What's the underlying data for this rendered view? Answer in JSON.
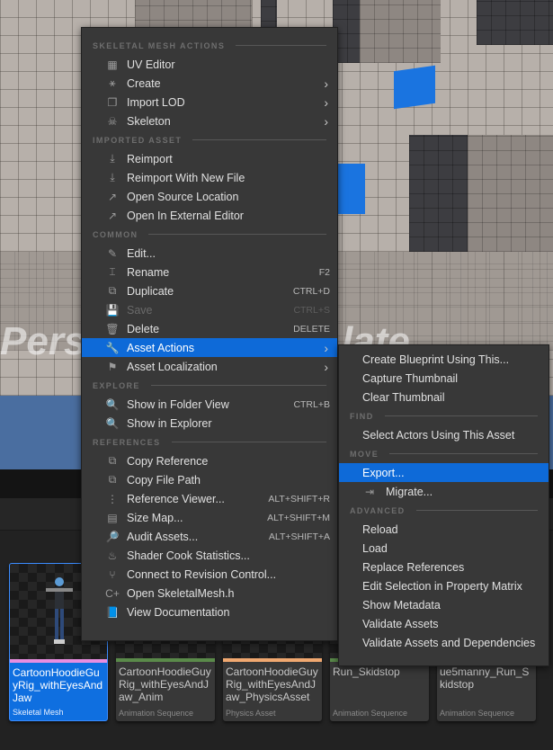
{
  "viewport": {
    "overlay_text_left": "Pers",
    "overlay_text_right": "late"
  },
  "main_menu": {
    "sections": [
      {
        "header": "SKELETAL MESH ACTIONS",
        "items": [
          {
            "label": "UV Editor",
            "icon": "uv-grid-icon",
            "glyph": "▦",
            "shortcut": "",
            "submenu": false
          },
          {
            "label": "Create",
            "icon": "create-animation-icon",
            "glyph": "⚹",
            "shortcut": "",
            "submenu": true
          },
          {
            "label": "Import LOD",
            "icon": "import-lod-icon",
            "glyph": "❐",
            "shortcut": "",
            "submenu": true
          },
          {
            "label": "Skeleton",
            "icon": "skeleton-icon",
            "glyph": "☠",
            "shortcut": "",
            "submenu": true
          }
        ]
      },
      {
        "header": "IMPORTED ASSET",
        "items": [
          {
            "label": "Reimport",
            "icon": "reimport-icon",
            "glyph": "⤓",
            "shortcut": "",
            "submenu": false
          },
          {
            "label": "Reimport With New File",
            "icon": "reimport-new-file-icon",
            "glyph": "⤓",
            "shortcut": "",
            "submenu": false
          },
          {
            "label": "Open Source Location",
            "icon": "open-source-location-icon",
            "glyph": "↗",
            "shortcut": "",
            "submenu": false
          },
          {
            "label": "Open In External Editor",
            "icon": "open-external-editor-icon",
            "glyph": "↗",
            "shortcut": "",
            "submenu": false
          }
        ]
      },
      {
        "header": "COMMON",
        "items": [
          {
            "label": "Edit...",
            "icon": "edit-pencil-icon",
            "glyph": "✎",
            "shortcut": "",
            "submenu": false
          },
          {
            "label": "Rename",
            "icon": "rename-icon",
            "glyph": "⌶",
            "shortcut": "F2",
            "submenu": false
          },
          {
            "label": "Duplicate",
            "icon": "duplicate-icon",
            "glyph": "⧉",
            "shortcut": "CTRL+D",
            "submenu": false
          },
          {
            "label": "Save",
            "icon": "save-icon",
            "glyph": "💾",
            "shortcut": "CTRL+S",
            "submenu": false,
            "disabled": true
          },
          {
            "label": "Delete",
            "icon": "trash-icon",
            "glyph": "🗑",
            "shortcut": "DELETE",
            "submenu": false
          },
          {
            "label": "Asset Actions",
            "icon": "wrench-icon",
            "glyph": "🔧",
            "shortcut": "",
            "submenu": true,
            "highlighted": true
          },
          {
            "label": "Asset Localization",
            "icon": "flag-icon",
            "glyph": "⚑",
            "shortcut": "",
            "submenu": true
          }
        ]
      },
      {
        "header": "EXPLORE",
        "items": [
          {
            "label": "Show in Folder View",
            "icon": "folder-search-icon",
            "glyph": "🔍",
            "shortcut": "CTRL+B",
            "submenu": false
          },
          {
            "label": "Show in Explorer",
            "icon": "folder-search-icon",
            "glyph": "🔍",
            "shortcut": "",
            "submenu": false
          }
        ]
      },
      {
        "header": "REFERENCES",
        "items": [
          {
            "label": "Copy Reference",
            "icon": "copy-reference-icon",
            "glyph": "⧉",
            "shortcut": "",
            "submenu": false
          },
          {
            "label": "Copy File Path",
            "icon": "copy-path-icon",
            "glyph": "⧉",
            "shortcut": "",
            "submenu": false
          },
          {
            "label": "Reference Viewer...",
            "icon": "reference-viewer-icon",
            "glyph": "⋮",
            "shortcut": "ALT+SHIFT+R",
            "submenu": false
          },
          {
            "label": "Size Map...",
            "icon": "size-map-icon",
            "glyph": "▤",
            "shortcut": "ALT+SHIFT+M",
            "submenu": false
          },
          {
            "label": "Audit Assets...",
            "icon": "audit-icon",
            "glyph": "🔎",
            "shortcut": "ALT+SHIFT+A",
            "submenu": false
          },
          {
            "label": "Shader Cook Statistics...",
            "icon": "shader-cook-icon",
            "glyph": "♨",
            "shortcut": "",
            "submenu": false
          },
          {
            "label": "Connect to Revision Control...",
            "icon": "revision-control-icon",
            "glyph": "⑂",
            "shortcut": "",
            "submenu": false
          },
          {
            "label": "Open SkeletalMesh.h",
            "icon": "cpp-file-icon",
            "glyph": "C+",
            "shortcut": "",
            "submenu": false
          },
          {
            "label": "View Documentation",
            "icon": "documentation-book-icon",
            "glyph": "📘",
            "shortcut": "",
            "submenu": false
          }
        ]
      }
    ]
  },
  "sub_menu": {
    "sections": [
      {
        "header": "",
        "items": [
          {
            "label": "Create Blueprint Using This...",
            "icon": "",
            "glyph": ""
          },
          {
            "label": "Capture Thumbnail",
            "icon": "",
            "glyph": ""
          },
          {
            "label": "Clear Thumbnail",
            "icon": "",
            "glyph": ""
          }
        ]
      },
      {
        "header": "FIND",
        "items": [
          {
            "label": "Select Actors Using This Asset",
            "icon": "",
            "glyph": ""
          }
        ]
      },
      {
        "header": "MOVE",
        "items": [
          {
            "label": "Export...",
            "icon": "",
            "glyph": "",
            "highlighted": true
          },
          {
            "label": "Migrate...",
            "icon": "migrate-icon",
            "glyph": "⇥"
          }
        ]
      },
      {
        "header": "ADVANCED",
        "items": [
          {
            "label": "Reload",
            "icon": "",
            "glyph": ""
          },
          {
            "label": "Load",
            "icon": "",
            "glyph": ""
          },
          {
            "label": "Replace References",
            "icon": "",
            "glyph": ""
          },
          {
            "label": "Edit Selection in Property Matrix",
            "icon": "",
            "glyph": ""
          },
          {
            "label": "Show Metadata",
            "icon": "",
            "glyph": ""
          },
          {
            "label": "Validate Assets",
            "icon": "",
            "glyph": ""
          },
          {
            "label": "Validate Assets and Dependencies",
            "icon": "",
            "glyph": ""
          }
        ]
      }
    ]
  },
  "assets": [
    {
      "name": "CartoonHoodieGuyRig_withEyesAndJaw",
      "type": "Skeletal Mesh",
      "strip_color": "#e88ee0",
      "selected": true
    },
    {
      "name": "CartoonHoodieGuyRig_withEyesAndJaw_Anim",
      "type": "Animation Sequence",
      "strip_color": "#5a8a4a",
      "selected": false
    },
    {
      "name": "CartoonHoodieGuyRig_withEyesAndJaw_PhysicsAsset",
      "type": "Physics Asset",
      "strip_color": "#f0a870",
      "selected": false
    },
    {
      "name": "Run_Skidstop",
      "type": "Animation Sequence",
      "strip_color": "#5a8a4a",
      "selected": false
    },
    {
      "name": "ue5manny_Run_Skidstop",
      "type": "Animation Sequence",
      "strip_color": "#5a8a4a",
      "selected": false
    }
  ],
  "colors": {
    "highlight": "#0e6ad8",
    "menu_bg": "#383838",
    "selected_tile": "#0f6fe0"
  }
}
